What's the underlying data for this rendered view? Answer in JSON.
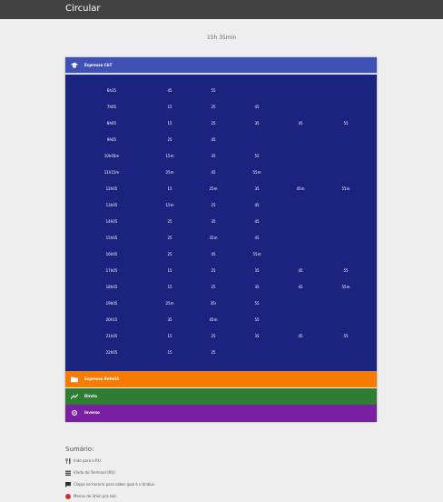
{
  "app": {
    "title": "Circular"
  },
  "current_time": "15h 35min",
  "sections": [
    {
      "label": "Expresso CbT",
      "icon": "graduation-cap-icon",
      "color": "#3f51b5"
    },
    {
      "label": "Expresso Refeitô",
      "icon": "folder-icon",
      "color": "#f57c00"
    },
    {
      "label": "Direto",
      "icon": "trending-up-icon",
      "color": "#2e7d32"
    },
    {
      "label": "Inverso",
      "icon": "cycle-icon",
      "color": "#7b1fa2"
    }
  ],
  "schedule": {
    "rows": [
      [
        "6h35",
        "45",
        "55"
      ],
      [
        "7h05",
        "15",
        "25",
        "45"
      ],
      [
        "8h05",
        "15",
        "25",
        "35",
        "45",
        "55"
      ],
      [
        "9h05",
        "25",
        "45"
      ],
      [
        "10h05m",
        "15m",
        "35",
        "55"
      ],
      [
        "11h15m",
        "25m",
        "45",
        "55m"
      ],
      [
        "12h05",
        "15",
        "25m",
        "35",
        "45m",
        "55m"
      ],
      [
        "13h05",
        "15m",
        "25",
        "45"
      ],
      [
        "14h05",
        "25",
        "35",
        "45"
      ],
      [
        "15h05",
        "25",
        "35m",
        "45"
      ],
      [
        "16h05",
        "25",
        "45",
        "55m"
      ],
      [
        "17h05",
        "15",
        "25",
        "35",
        "45",
        "55"
      ],
      [
        "18h05",
        "15",
        "25",
        "35",
        "45",
        "55m"
      ],
      [
        "19h05",
        "25m",
        "35r",
        "55"
      ],
      [
        "20h15",
        "35",
        "45m",
        "55"
      ],
      [
        "21h05",
        "15",
        "25",
        "35",
        "45",
        "55"
      ],
      [
        "22h05",
        "15",
        "25"
      ]
    ],
    "highlight": {
      "row": 9,
      "col": 4
    },
    "highlight_color": "#43a047"
  },
  "summary": {
    "title": "Sumário:",
    "items": [
      {
        "icon": "fork-knife-icon",
        "text": "Indo para o RU."
      },
      {
        "icon": "list-icon",
        "text": "Vindo do Terminal (RU)."
      },
      {
        "icon": "comment-icon",
        "text": "Clique no horario para saber qual é o ônibus."
      },
      {
        "icon": "red-dot-icon",
        "text": "Menos de 3min pra sair.",
        "color": "#d32f2f"
      }
    ]
  }
}
